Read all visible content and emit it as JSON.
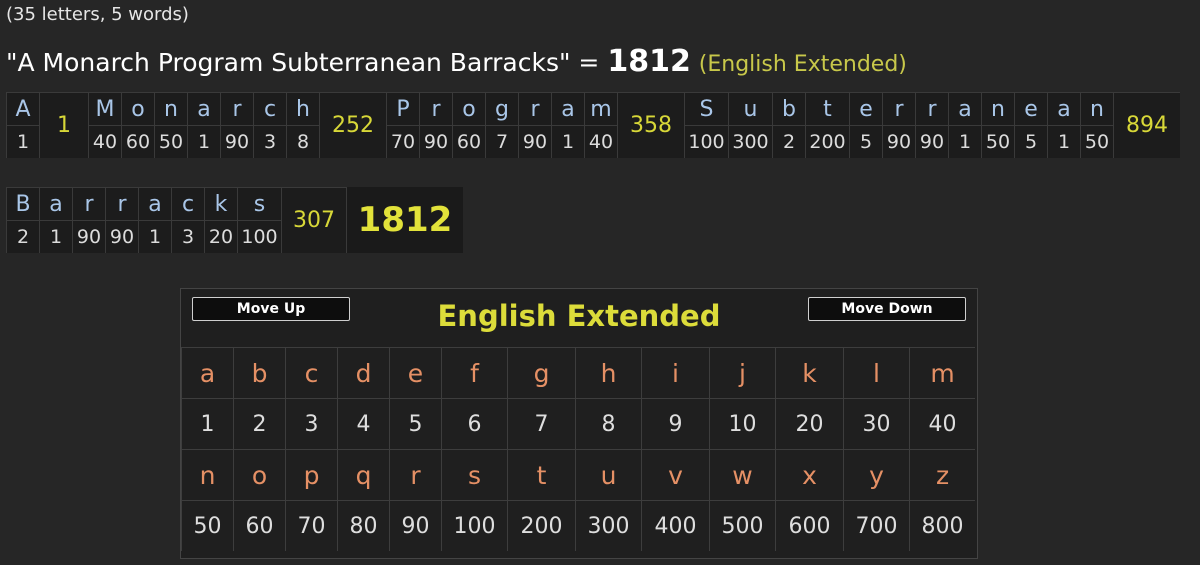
{
  "summary": {
    "counts": "(35 letters, 5 words)"
  },
  "phrase": {
    "text": "\"A Monarch Program Subterranean Barracks\"",
    "equals": "=",
    "total": "1812",
    "cipher_label": "(English Extended)"
  },
  "breakdown": {
    "row1": [
      {
        "letters": [
          "A"
        ],
        "values": [
          "1"
        ],
        "sum": "1"
      },
      {
        "letters": [
          "M",
          "o",
          "n",
          "a",
          "r",
          "c",
          "h"
        ],
        "values": [
          "40",
          "60",
          "50",
          "1",
          "90",
          "3",
          "8"
        ],
        "sum": "252"
      },
      {
        "letters": [
          "P",
          "r",
          "o",
          "g",
          "r",
          "a",
          "m"
        ],
        "values": [
          "70",
          "90",
          "60",
          "7",
          "90",
          "1",
          "40"
        ],
        "sum": "358"
      },
      {
        "letters": [
          "S",
          "u",
          "b",
          "t",
          "e",
          "r",
          "r",
          "a",
          "n",
          "e",
          "a",
          "n"
        ],
        "values": [
          "100",
          "300",
          "2",
          "200",
          "5",
          "90",
          "90",
          "1",
          "50",
          "5",
          "1",
          "50"
        ],
        "sum": "894"
      }
    ],
    "row2": [
      {
        "letters": [
          "B",
          "a",
          "r",
          "r",
          "a",
          "c",
          "k",
          "s"
        ],
        "values": [
          "2",
          "1",
          "90",
          "90",
          "1",
          "3",
          "20",
          "100"
        ],
        "sum": "307"
      }
    ],
    "grand_total": "1812"
  },
  "cipher_table": {
    "title": "English Extended",
    "move_up_label": "Move Up",
    "move_down_label": "Move Down",
    "letters_row1": [
      "a",
      "b",
      "c",
      "d",
      "e",
      "f",
      "g",
      "h",
      "i",
      "j",
      "k",
      "l",
      "m"
    ],
    "values_row1": [
      "1",
      "2",
      "3",
      "4",
      "5",
      "6",
      "7",
      "8",
      "9",
      "10",
      "20",
      "30",
      "40"
    ],
    "letters_row2": [
      "n",
      "o",
      "p",
      "q",
      "r",
      "s",
      "t",
      "u",
      "v",
      "w",
      "x",
      "y",
      "z"
    ],
    "values_row2": [
      "50",
      "60",
      "70",
      "80",
      "90",
      "100",
      "200",
      "300",
      "400",
      "500",
      "600",
      "700",
      "800"
    ]
  },
  "colors": {
    "letter": "#a9c6e8",
    "sum": "#d8d838",
    "title": "#dcdc3a",
    "cipher_letter": "#e59065",
    "background": "#262626"
  }
}
